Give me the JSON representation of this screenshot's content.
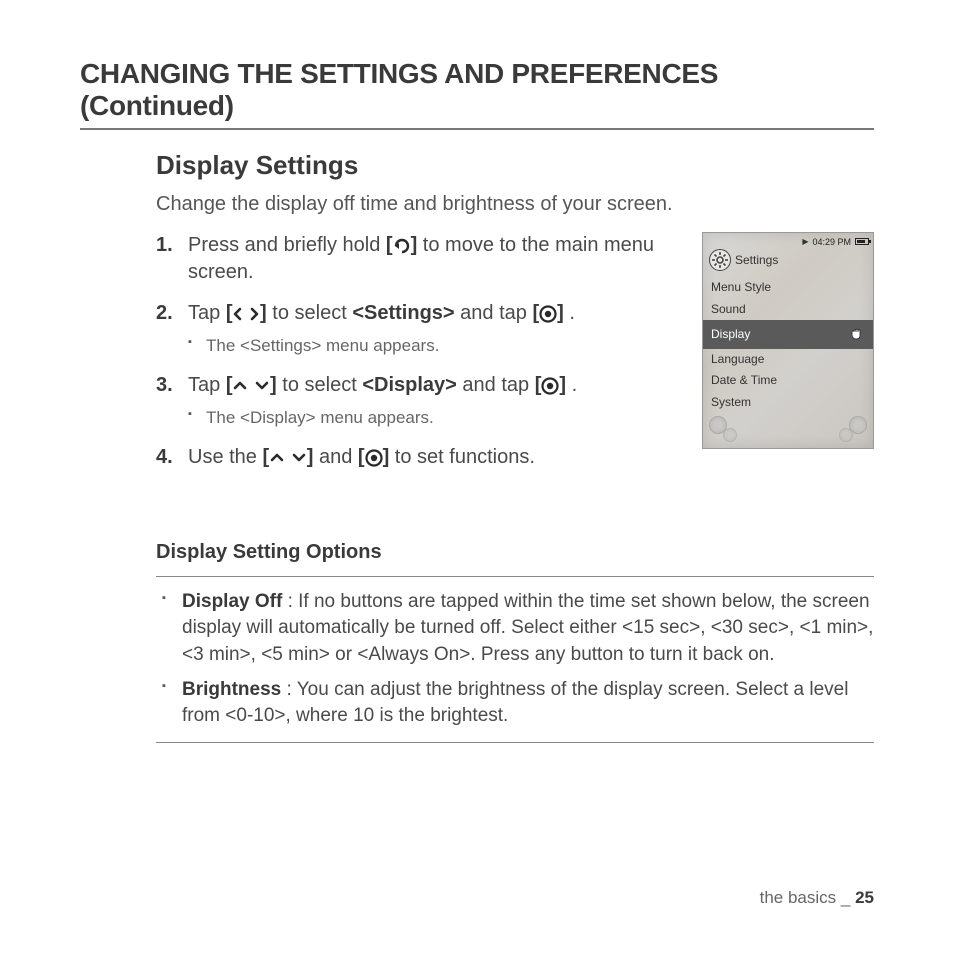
{
  "chapter_title": "CHANGING THE SETTINGS AND PREFERENCES (Continued)",
  "section_title": "Display Settings",
  "intro": "Change the display off time and brightness of your screen.",
  "steps": {
    "s1a": "Press and briefly hold ",
    "s1b": " to move to the main menu screen.",
    "s2a": "Tap ",
    "s2b": " to select ",
    "s2c": "<Settings>",
    "s2d": " and tap ",
    "s2e": ".",
    "s2_sub": "The <Settings> menu appears.",
    "s3a": "Tap ",
    "s3b": " to select ",
    "s3c": "<Display>",
    "s3d": " and tap ",
    "s3e": ".",
    "s3_sub": "The <Display> menu appears.",
    "s4a": "Use the ",
    "s4b": " and ",
    "s4c": " to set functions."
  },
  "bracket_open": "[",
  "bracket_close": "]",
  "device": {
    "time": "04:29 PM",
    "title": "Settings",
    "items": [
      "Menu Style",
      "Sound",
      "Display",
      "Language",
      "Date & Time",
      "System"
    ],
    "selected_index": 2
  },
  "options_title": "Display Setting Options",
  "options": {
    "o1_label": "Display Off",
    "o1_text": " : If no buttons are tapped within the time set shown below, the screen display will automatically be turned off. Select either <15 sec>, <30 sec>, <1 min>, <3 min>, <5 min> or <Always On>. Press any button to turn it back on.",
    "o2_label": "Brightness",
    "o2_text": " : You can adjust the brightness of the display screen. Select a level from <0-10>, where 10 is the brightest."
  },
  "footer_text": "the basics _ ",
  "page_number": "25"
}
